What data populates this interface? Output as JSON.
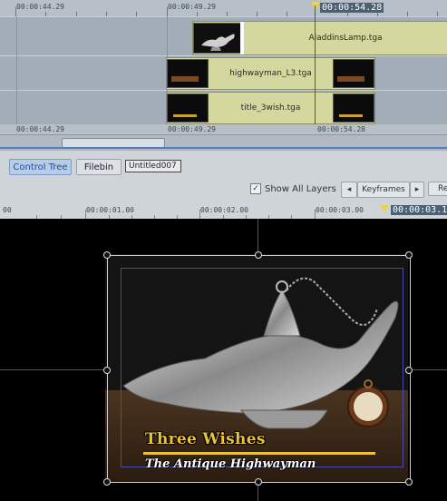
{
  "timeline": {
    "ruler_labels": [
      "00:00:44.29",
      "00:00:49.29"
    ],
    "bottom_labels": [
      "00:00:44.29",
      "00:00:49.29",
      "00:00:54.28"
    ],
    "playhead_time": "00:00:54.28",
    "clips": [
      {
        "name": "AladdinsLamp.tga"
      },
      {
        "name": "highwayman_L3.tga"
      },
      {
        "name": "title_3wish.tga"
      }
    ]
  },
  "tabs": [
    {
      "label": "Control Tree",
      "active": true
    },
    {
      "label": "Filebin",
      "active": false
    }
  ],
  "untitled_label": "Untitled007",
  "show_all_layers": {
    "label": "Show All Layers",
    "checked": true,
    "check_glyph": "✓"
  },
  "keyframes": {
    "prev_glyph": "◂",
    "label": "Keyframes",
    "next_glyph": "▸",
    "cut_label": "Re"
  },
  "ruler2": {
    "labels": [
      "00",
      "00:00:01.00",
      "00:00:02.00",
      "00:00:03.00"
    ],
    "current_time": "00:00:03.1"
  },
  "preview": {
    "title_line1": "Three Wishes",
    "title_line2": "The Antique Highwayman"
  },
  "colors": {
    "accent_tab": "#1f4e9c",
    "clip": "#d4d89e",
    "title_gold": "#e9c239"
  }
}
